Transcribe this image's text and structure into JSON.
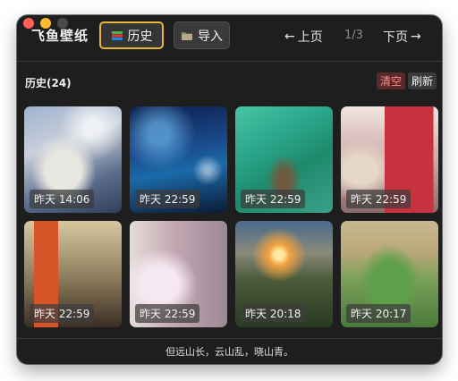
{
  "app": {
    "title": "飞鱼壁纸"
  },
  "toolbar": {
    "history_label": "历史",
    "import_label": "导入",
    "prev_label": "上页",
    "next_label": "下页",
    "page_indicator": "1/3"
  },
  "section": {
    "title": "历史(24)",
    "clear_label": "清空",
    "refresh_label": "刷新"
  },
  "wallpapers": [
    {
      "time": "昨天 14:06"
    },
    {
      "time": "昨天 22:59"
    },
    {
      "time": "昨天 22:59"
    },
    {
      "time": "昨天 22:59"
    },
    {
      "time": "昨天 22:59"
    },
    {
      "time": "昨天 22:59"
    },
    {
      "time": "昨天 20:18"
    },
    {
      "time": "昨天 20:17"
    }
  ],
  "footer": {
    "quote": "但远山长，云山乱，晓山青。"
  },
  "colors": {
    "accent": "#e8b43c",
    "clear_text": "#ff8c8c",
    "background": "#1e1e1e"
  },
  "icons": {
    "history": "books-icon",
    "import": "folder-icon",
    "prev": "arrow-left-icon",
    "next": "arrow-right-icon"
  }
}
